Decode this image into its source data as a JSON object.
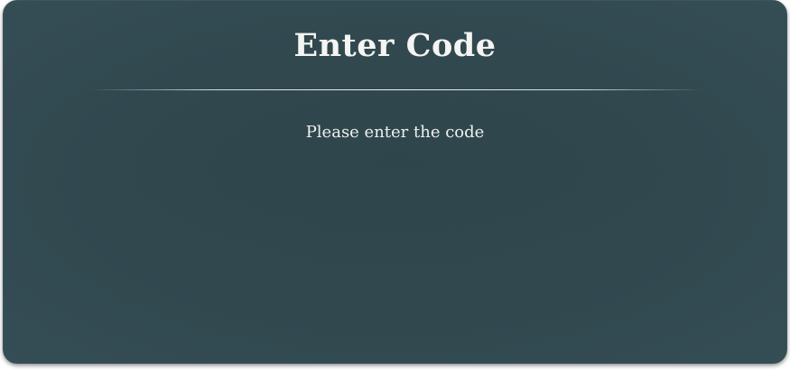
{
  "dialog": {
    "title": "Enter Code",
    "message": "Please enter the code"
  },
  "colors": {
    "background": "#31484f",
    "text": "#f4f4f2"
  }
}
